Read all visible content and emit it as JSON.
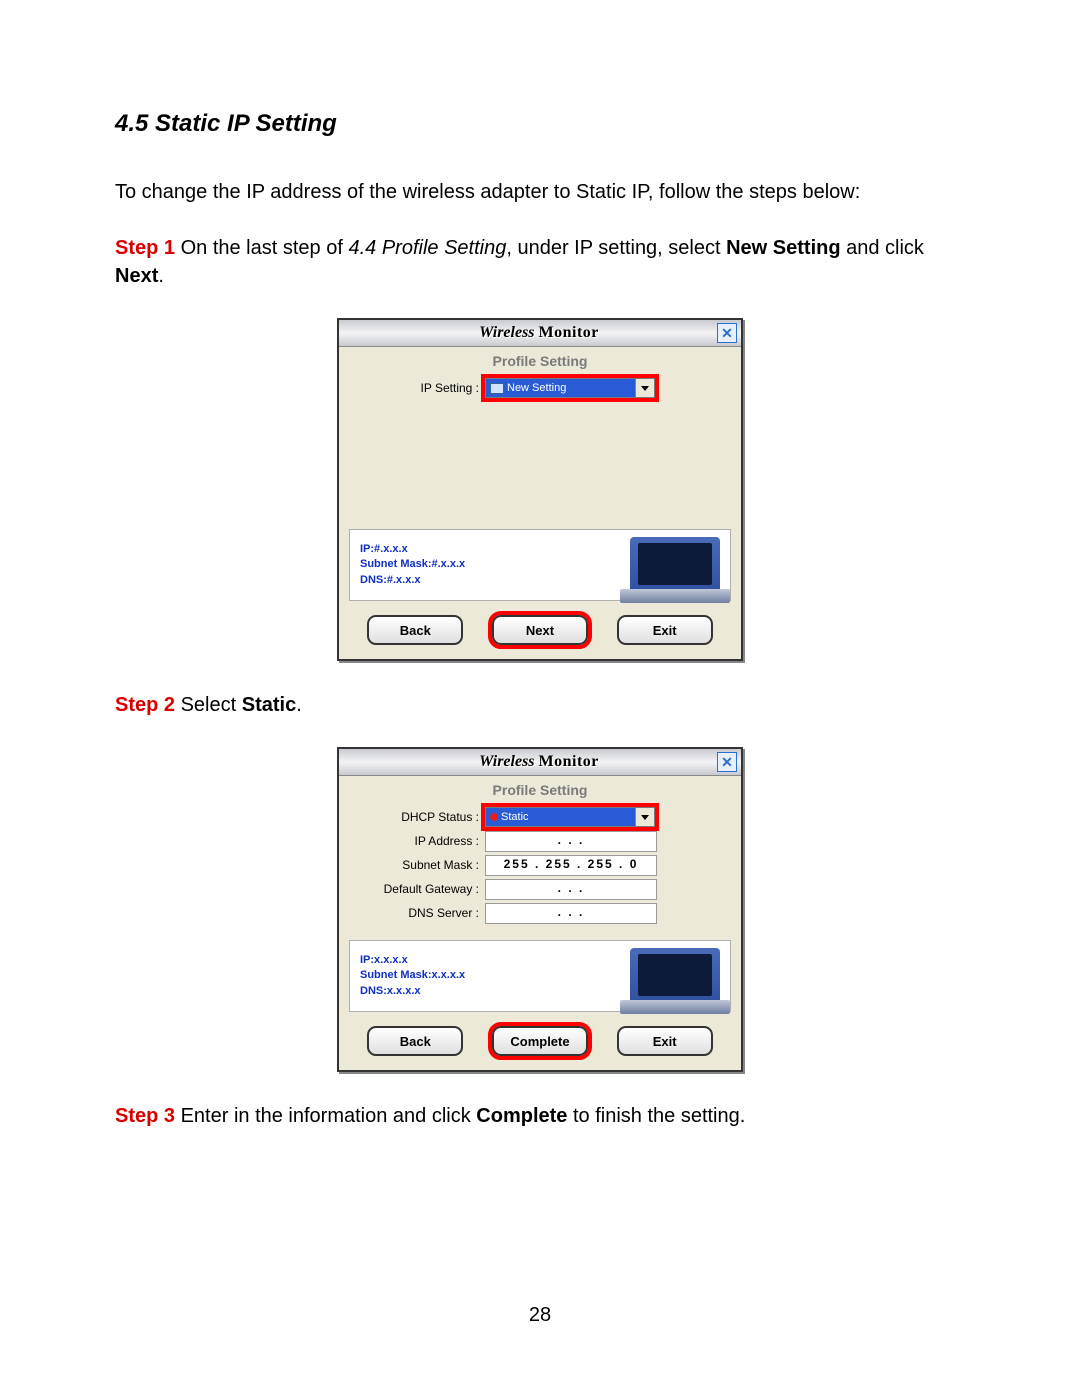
{
  "heading": "4.5 Static IP Setting",
  "intro": "To change the IP address of the wireless adapter to Static IP, follow the steps below:",
  "step1": {
    "label": "Step 1",
    "t1": " On the last step of ",
    "ref": "4.4 Profile Setting",
    "t2": ", under IP setting, select ",
    "b1": "New Setting",
    "t3": " and click ",
    "b2": "Next",
    "t4": "."
  },
  "step2": {
    "label": "Step 2",
    "t1": " Select ",
    "b1": "Static",
    "t2": "."
  },
  "step3": {
    "label": "Step 3",
    "t1": " Enter in the information and click ",
    "b1": "Complete",
    "t2": " to finish the setting."
  },
  "page_number": "28",
  "dialog_common": {
    "title_prefix": "Wireless",
    "title_suffix": "Monitor",
    "close": "✕",
    "subheader": "Profile Setting",
    "back": "Back",
    "exit": "Exit"
  },
  "dialog1": {
    "ip_setting_label": "IP Setting :",
    "ip_setting_value": "New Setting",
    "info_ip": "IP:#.x.x.x",
    "info_mask": "Subnet Mask:#.x.x.x",
    "info_dns": "DNS:#.x.x.x",
    "next": "Next"
  },
  "dialog2": {
    "dhcp_label": "DHCP Status :",
    "dhcp_value": "Static",
    "ip_label": "IP Address :",
    "ip_value": ".       .       .",
    "mask_label": "Subnet Mask :",
    "mask_value": "255 . 255 . 255 .  0",
    "gw_label": "Default Gateway :",
    "gw_value": ".       .       .",
    "dns_label": "DNS Server :",
    "dns_value": ".       .       .",
    "info_ip": "IP:x.x.x.x",
    "info_mask": "Subnet Mask:x.x.x.x",
    "info_dns": "DNS:x.x.x.x",
    "complete": "Complete"
  }
}
